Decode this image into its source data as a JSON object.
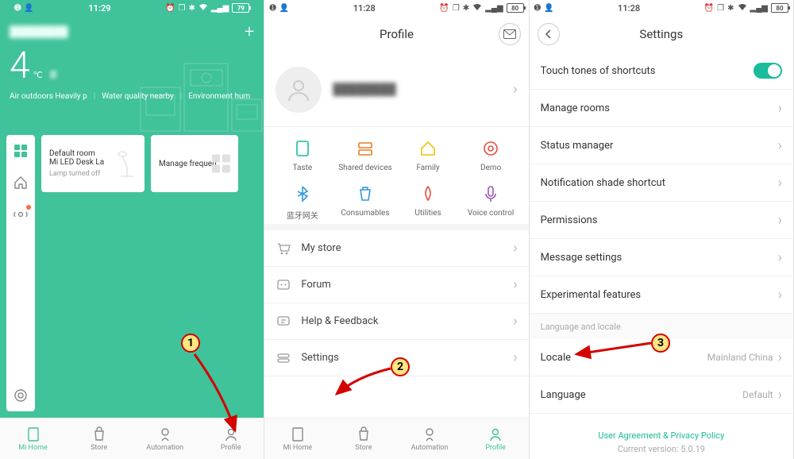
{
  "status_bar": {
    "time": "11:28",
    "time_s1": "11:29",
    "battery": "79",
    "battery_s2": "80",
    "battery_s3": "80"
  },
  "screen1": {
    "location_label": "████████",
    "temperature": "4",
    "temp_unit": "℃",
    "temp_desc": "雾",
    "env": {
      "air": "Air outdoors Heavily p",
      "water": "Water quality nearby",
      "env": "Environment hum"
    },
    "card1": {
      "title": "Default room",
      "device": "Mi LED Desk La",
      "status": "Lamp turned off"
    },
    "card2": {
      "title": "Manage frequen"
    },
    "tabs": {
      "home": "Mi Home",
      "store": "Store",
      "automation": "Automation",
      "profile": "Profile"
    }
  },
  "screen2": {
    "title": "Profile",
    "profile_name": "████████",
    "grid": {
      "taste": "Taste",
      "shared": "Shared devices",
      "family": "Family",
      "demo": "Demo",
      "bt": "蓝牙网关",
      "consumables": "Consumables",
      "utilities": "Utilities",
      "voice": "Voice control"
    },
    "menu": {
      "store": "My store",
      "forum": "Forum",
      "help": "Help & Feedback",
      "settings": "Settings"
    },
    "tabs": {
      "home": "Mi Home",
      "store": "Store",
      "automation": "Automation",
      "profile": "Profile"
    }
  },
  "screen3": {
    "title": "Settings",
    "items": {
      "touch_tones": "Touch tones of shortcuts",
      "manage_rooms": "Manage rooms",
      "status_manager": "Status manager",
      "notification": "Notification shade shortcut",
      "permissions": "Permissions",
      "message": "Message settings",
      "experimental": "Experimental features"
    },
    "section": "Language and locale",
    "locale_label": "Locale",
    "locale_value": "Mainland China",
    "language_label": "Language",
    "language_value": "Default",
    "footer_link": "User Agreement & Privacy Policy",
    "footer_version": "Current version: 5.0.19"
  },
  "annotations": {
    "a1": "1",
    "a2": "2",
    "a3": "3"
  }
}
